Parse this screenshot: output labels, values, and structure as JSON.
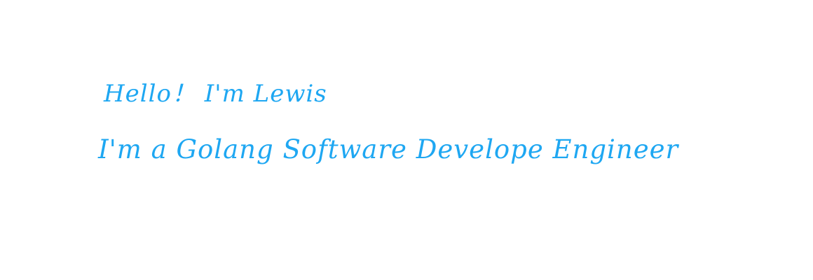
{
  "greeting": {
    "line_1": "Hello！ I'm Lewis",
    "line_2": "I'm a Golang Software Develope Engineer"
  },
  "colors": {
    "text": "#1ea7f2",
    "background": "#ffffff"
  }
}
